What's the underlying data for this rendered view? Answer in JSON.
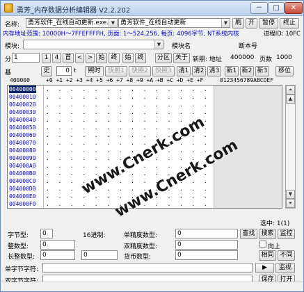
{
  "window": {
    "title": "勇芳_内存数据分析编辑器 V2.2.202",
    "controls": [
      "－",
      "□",
      "✕"
    ]
  },
  "toolbar1": {
    "name_label": "名称:",
    "process_value": "勇芳软件_在线自动更新.exe.",
    "window_value": "勇芳软件_在线自动更新",
    "refresh": "刷",
    "open": "开",
    "pause": "暂停",
    "stop": "终止"
  },
  "info": {
    "text": "内存地址范围: 10000H～7FFEFFFFH, 页面: 1～524,256, 每页: 4096字节, NT系统内核",
    "pid": "进程ID: 10FC"
  },
  "module_row": {
    "module_label": "模块:",
    "module_value": "",
    "module_name_label": "模块名",
    "base_label": "断本号"
  },
  "nav_row": {
    "divider_label": "分",
    "page_input": "1",
    "btn_page": "1",
    "btn_4": "4",
    "btn_first": "首",
    "btn_prev": "<",
    "btn_next": ">",
    "btn_start": "始",
    "btn_end": "终",
    "btn_start2": "始",
    "btn_end2": "终",
    "btn_partition": "分区",
    "btn_about": "关于",
    "new_addr_label": "新照: 地址",
    "new_addr_value": "400000",
    "page_count_label": "页数",
    "page_count_value": "1000"
  },
  "base_row": {
    "base_label": "基",
    "history_btn": "史",
    "zero_input": "0",
    "t_label": "t",
    "photo_btn": "照时",
    "snap1": "快照1",
    "snap2": "快照2",
    "snap3": "快照3",
    "clear1": "清1",
    "clear2": "清2",
    "clear3": "清3",
    "new1": "新1",
    "new2": "新2",
    "new3": "新3",
    "shift": "移位"
  },
  "hex": {
    "header_addr": "400000",
    "header_cols": "+0 +1 +2 +3 +4 +5 +6 +7 +8 +9 +A +B +C +D +E +F",
    "header_ascii": "0123456789ABCDEF",
    "rows": [
      {
        "addr": "00400000",
        "selected": true
      },
      {
        "addr": "00400010"
      },
      {
        "addr": "00400020"
      },
      {
        "addr": "00400030"
      },
      {
        "addr": "00400040"
      },
      {
        "addr": "00400050"
      },
      {
        "addr": "00400060"
      },
      {
        "addr": "00400070"
      },
      {
        "addr": "00400080"
      },
      {
        "addr": "00400090"
      },
      {
        "addr": "004000A0"
      },
      {
        "addr": "004000B0"
      },
      {
        "addr": "004000C0"
      },
      {
        "addr": "004000D0"
      },
      {
        "addr": "004000E0"
      },
      {
        "addr": "004000F0"
      }
    ]
  },
  "watermarks": [
    "www.Cnerk.com",
    "www.Cnerk.com"
  ],
  "bottom": {
    "selected_label": "选中: 1(1)",
    "byte_type_label": "字节型:",
    "byte_type_value": "0",
    "hex_label": "16进制:",
    "hex_value": "",
    "single_label": "单精度数型:",
    "single_value": "0",
    "find_btn": "查找",
    "search_btn": "搜索",
    "monitor_btn": "监控",
    "int_label": "整数型:",
    "int_value": "0",
    "double_label": "双精度数型:",
    "double_value": "0",
    "up_label": "向上",
    "long_label": "长整数型:",
    "long_value": "0",
    "long_hex_value": "0",
    "currency_label": "货币数型:",
    "currency_value": "0",
    "same_btn": "相同",
    "diff_btn": "不同",
    "single_str_label": "单字节字符:",
    "single_str_value": "",
    "watch_btn": "监视",
    "double_str_label": "双字节字符:",
    "double_str_value": "",
    "save_btn": "保存",
    "open_btn": "打开"
  }
}
